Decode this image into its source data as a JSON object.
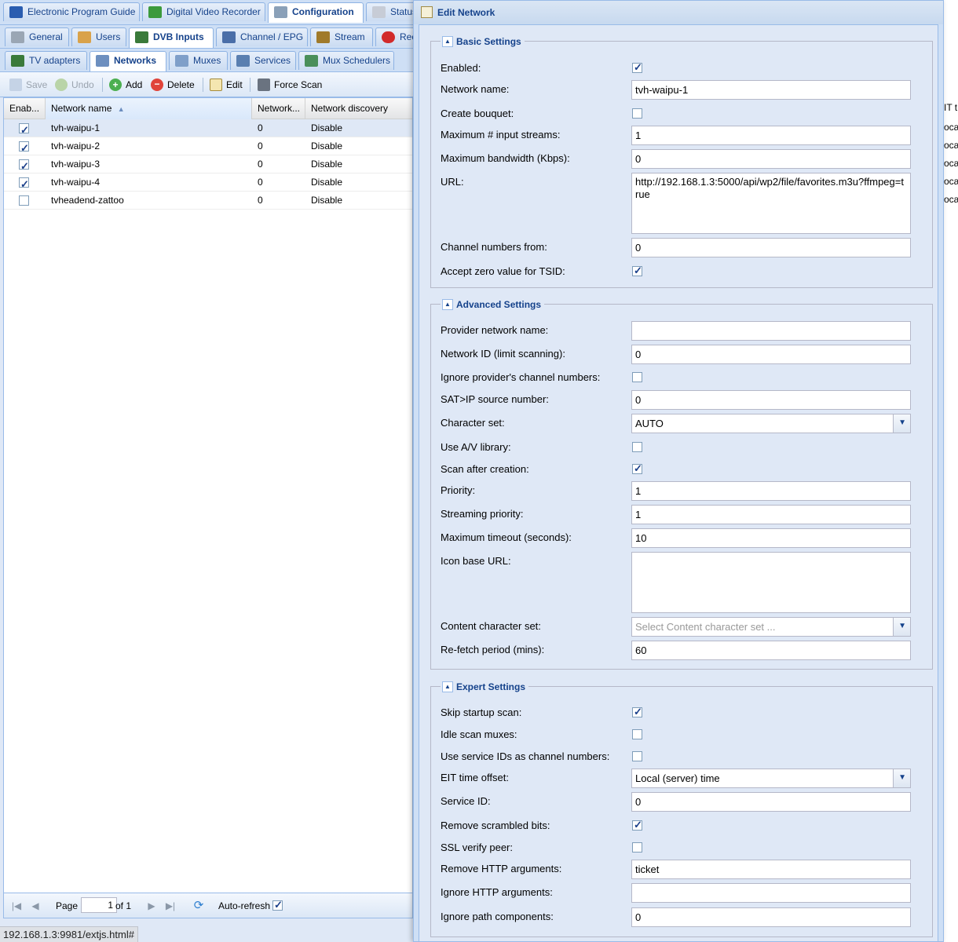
{
  "tabs_main": [
    {
      "label": "Electronic Program Guide",
      "icon": "epg-icon"
    },
    {
      "label": "Digital Video Recorder",
      "icon": "download-icon"
    },
    {
      "label": "Configuration",
      "icon": "wrench-icon",
      "active": true
    },
    {
      "label": "Status",
      "icon": "eye-icon"
    }
  ],
  "tabs_config": [
    {
      "label": "General",
      "icon": "tools-icon"
    },
    {
      "label": "Users",
      "icon": "users-icon"
    },
    {
      "label": "DVB Inputs",
      "icon": "card-icon",
      "active": true
    },
    {
      "label": "Channel / EPG",
      "icon": "tv-icon"
    },
    {
      "label": "Stream",
      "icon": "stream-icon"
    },
    {
      "label": "Rec",
      "icon": "rec-icon"
    }
  ],
  "tabs_dvb": [
    {
      "label": "TV adapters",
      "icon": "adapter-icon"
    },
    {
      "label": "Networks",
      "icon": "antenna-icon",
      "active": true
    },
    {
      "label": "Muxes",
      "icon": "muxes-icon"
    },
    {
      "label": "Services",
      "icon": "services-icon"
    },
    {
      "label": "Mux Schedulers",
      "icon": "scheduler-icon"
    }
  ],
  "toolbar": {
    "save": "Save",
    "undo": "Undo",
    "add": "Add",
    "delete": "Delete",
    "edit": "Edit",
    "force_scan": "Force Scan"
  },
  "grid": {
    "columns": [
      "Enab...",
      "Network name",
      "Network...",
      "Network discovery"
    ],
    "rows": [
      {
        "enabled": true,
        "name": "tvh-waipu-1",
        "num": "0",
        "discovery": "Disable",
        "selected": true
      },
      {
        "enabled": true,
        "name": "tvh-waipu-2",
        "num": "0",
        "discovery": "Disable"
      },
      {
        "enabled": true,
        "name": "tvh-waipu-3",
        "num": "0",
        "discovery": "Disable"
      },
      {
        "enabled": true,
        "name": "tvh-waipu-4",
        "num": "0",
        "discovery": "Disable"
      },
      {
        "enabled": false,
        "name": "tvheadend-zattoo",
        "num": "0",
        "discovery": "Disable"
      }
    ]
  },
  "right_strip": {
    "header": "IT t",
    "cell": "oca"
  },
  "pager": {
    "page_label": "Page",
    "page_value": "1",
    "of_label": "of 1",
    "auto_refresh": "Auto-refresh"
  },
  "status_url": "192.168.1.3:9981/extjs.html#",
  "dialog": {
    "title": "Edit Network",
    "basic": {
      "legend": "Basic Settings",
      "enabled_label": "Enabled:",
      "network_name_label": "Network name:",
      "network_name": "tvh-waipu-1",
      "create_bouquet_label": "Create bouquet:",
      "max_streams_label": "Maximum # input streams:",
      "max_streams": "1",
      "max_bw_label": "Maximum bandwidth (Kbps):",
      "max_bw": "0",
      "url_label": "URL:",
      "url": "http://192.168.1.3:5000/api/wp2/file/favorites.m3u?ffmpeg=true",
      "chan_from_label": "Channel numbers from:",
      "chan_from": "0",
      "zero_tsid_label": "Accept zero value for TSID:"
    },
    "advanced": {
      "legend": "Advanced Settings",
      "provider_label": "Provider network name:",
      "provider": "",
      "netid_label": "Network ID (limit scanning):",
      "netid": "0",
      "ignore_chnum_label": "Ignore provider's channel numbers:",
      "satip_label": "SAT>IP source number:",
      "satip": "0",
      "charset_label": "Character set:",
      "charset": "AUTO",
      "av_label": "Use A/V library:",
      "scan_after_label": "Scan after creation:",
      "priority_label": "Priority:",
      "priority": "1",
      "stream_prio_label": "Streaming priority:",
      "stream_prio": "1",
      "timeout_label": "Maximum timeout (seconds):",
      "timeout": "10",
      "icon_url_label": "Icon base URL:",
      "icon_url": "",
      "content_cs_label": "Content character set:",
      "content_cs_placeholder": "Select Content character set ...",
      "refetch_label": "Re-fetch period (mins):",
      "refetch": "60"
    },
    "expert": {
      "legend": "Expert Settings",
      "skip_label": "Skip startup scan:",
      "idle_label": "Idle scan muxes:",
      "sid_chnum_label": "Use service IDs as channel numbers:",
      "eit_label": "EIT time offset:",
      "eit": "Local (server) time",
      "sid_label": "Service ID:",
      "sid": "0",
      "scrambled_label": "Remove scrambled bits:",
      "ssl_label": "SSL verify peer:",
      "remove_http_label": "Remove HTTP arguments:",
      "remove_http": "ticket",
      "ignore_http_label": "Ignore HTTP arguments:",
      "ignore_http": "",
      "ignore_path_label": "Ignore path components:",
      "ignore_path": "0"
    }
  },
  "colors": {
    "accent": "#15428b",
    "panel": "#dfe8f6",
    "border": "#99bbe8"
  }
}
